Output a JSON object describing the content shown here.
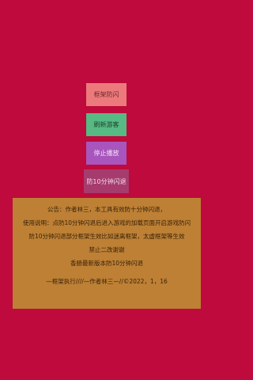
{
  "buttons": {
    "frame_dodge": "框架防闪",
    "refresh_guest": "刷新游客",
    "stop_play": "停止播放",
    "anti_dodge_10min": "防10分钟闪退"
  },
  "notice": {
    "line1": "公告：作者林三，本工具有效防十分钟闪退，",
    "line2": "使用说明：点防10分钟闪退后进入游戏的加载页面开启游戏防闪",
    "line3": "防10分钟闪退部分框架生效比如迷离框架，太虚框架等生效",
    "line4": "禁止二改谢谢",
    "line5": "香肠最新版本防10分钟闪退",
    "signature": "—框架执行////—作者林三—//©2022，1，16"
  },
  "colors": {
    "background": "#be0a3c",
    "frame_dodge": "#ec7a7c",
    "refresh_guest": "#57b983",
    "stop_play": "#a856bd",
    "anti_dodge_10min": "#a63b6e",
    "notice_panel": "#bd8035"
  }
}
